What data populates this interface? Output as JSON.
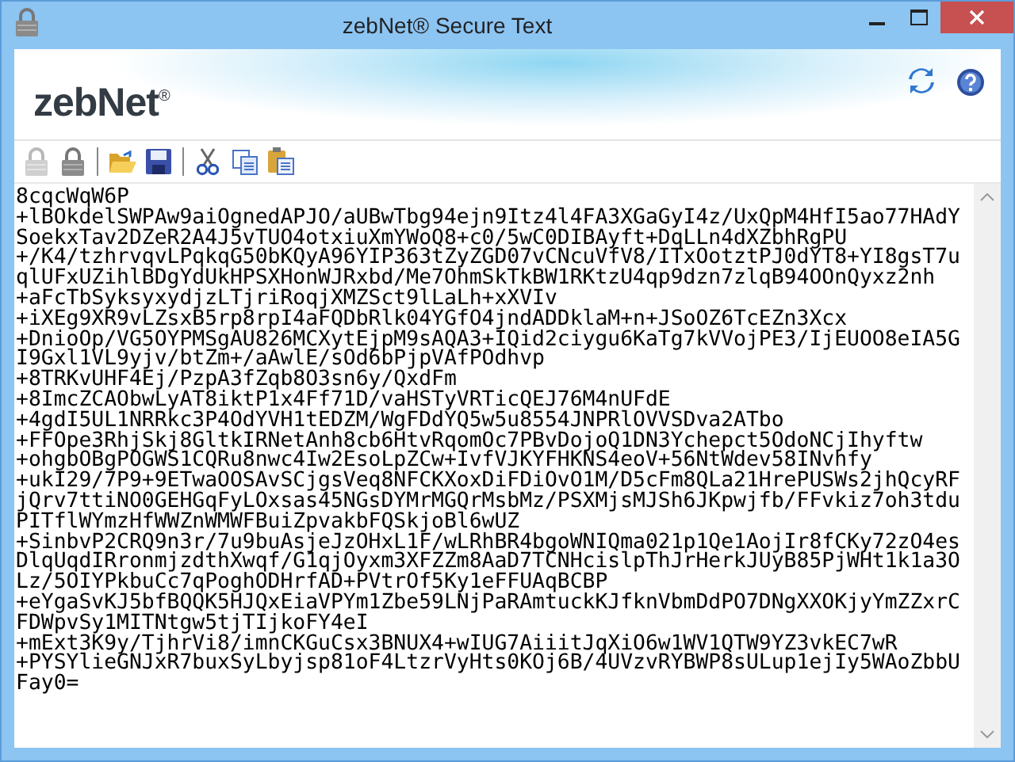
{
  "window": {
    "title": "zebNet® Secure Text"
  },
  "header": {
    "logo": "zebNet$^{®}$"
  },
  "toolbar": [
    {
      "kind": "lock",
      "disabled": true
    },
    {
      "kind": "lock",
      "disabled": false
    },
    {
      "kind": "separator"
    },
    {
      "kind": "open"
    },
    {
      "kind": "save"
    },
    {
      "kind": "separator"
    },
    {
      "kind": "cut"
    },
    {
      "kind": "copy"
    },
    {
      "kind": "paste"
    }
  ],
  "editor": {
    "lines": [
      "8cqcWqW6P",
      "+lBOkdelSWPAw9aiOgnedAPJO/aUBwTbg94ejn9Itz4l4FA3XGaGyI4z/UxQpM4HfI5ao77HAdY",
      "SoekxTav2DZeR2A4J5vTUO4otxiuXmYWoQ8+c0/5wC0DIBAyft+DqLLn4dXZbhRgPU",
      "+/K4/tzhrvqvLPqkqG50bKQyA96YIP363tZyZGD07vCNcuVfV8/ITxOotztPJ0dYT8+YI8gsT7u",
      "qlUFxUZihlBDgYdUkHPSXHonWJRxbd/Me7OhmSkTkBW1RKtzU4qp9dzn7zlqB94OOnQyxz2nh",
      "+aFcTbSyksyxydjzLTjriRoqjXMZSct9lLaLh+xXVIv",
      "+iXEg9XR9vLZsxB5rp8rpI4aFQDbRlk04YGfO4jndADDklaM+n+JSoOZ6TcEZn3Xcx",
      "+DnioOp/VG5OYPMSgAU826MCXytEjpM9sAQA3+IQid2ciygu6KaTg7kVVojPE3/IjEUOO8eIA5G",
      "I9Gxl1VL9yjv/btZm+/aAwlE/sOd6bPjpVAfPOdhvp",
      "+8TRKvUHF4Ej/PzpA3fZqb8O3sn6y/QxdFm",
      "+8ImcZCAObwLyAT8iktP1x4Ff71D/vaHSTyVRTicQEJ76M4nUFdE",
      "+4gdI5UL1NRRkc3P4OdYVH1tEDZM/WgFDdYQ5w5u8554JNPRlOVVSDva2ATbo",
      "+FFOpe3RhjSkj8GltkIRNetAnh8cb6HtvRqomOc7PBvDojoQ1DN3Ychepct5OdoNCjIhyftw",
      "+ohgbOBgPOGWS1CQRu8nwc4Iw2EsoLpZCw+IvfVJKYFHKNS4eoV+56NtWdev58INvhfy",
      "+ukI29/7P9+9ETwaOOSAvSCjgsVeq8NFCKXoxDiFDiOvO1M/D5cFm8QLa21HrePUSWs2jhQcyRF",
      "jQrv7ttiNO0GEHGqFyLOxsas45NGsDYMrMGQrMsbMz/PSXMjsMJSh6JKpwjfb/FFvkiz7oh3tdu",
      "PITflWYmzHfWWZnWMWFBuiZpvakbFQSkjoBl6wUZ",
      "+SinbvP2CRQ9n3r/7u9buAsjeJzOHxL1F/wLRhBR4bgoWNIQma021p1Qe1AojIr8fCKy72zO4es",
      "DlqUqdIRronmjzdthXwqf/G1qjOyxm3XFZZm8AaD7TCNHcislpThJrHerkJUyB85PjWHt1k1a3O",
      "Lz/5OIYPkbuCc7qPoghODHrfAD+PVtrOf5Ky1eFFUAqBCBP",
      "+eYgaSvKJ5bfBQQK5HJQxEiaVPYm1Zbe59LNjPaRAmtuckKJfknVbmDdPO7DNgXXOKjyYmZZxrC",
      "FDWpvSy1MITNtgw5tjTIjkoFY4eI",
      "+mExt3K9y/TjhrVi8/imnCKGuCsx3BNUX4+wIUG7AiiitJqXiO6w1WV1QTW9YZ3vkEC7wR",
      "+PYSYlieGNJxR7buxSyLbyjsp81oF4LtzrVyHts0KOj6B/4UVzvRYBWP8sULup1ejIy5WAoZbbU",
      "Fay0="
    ]
  }
}
